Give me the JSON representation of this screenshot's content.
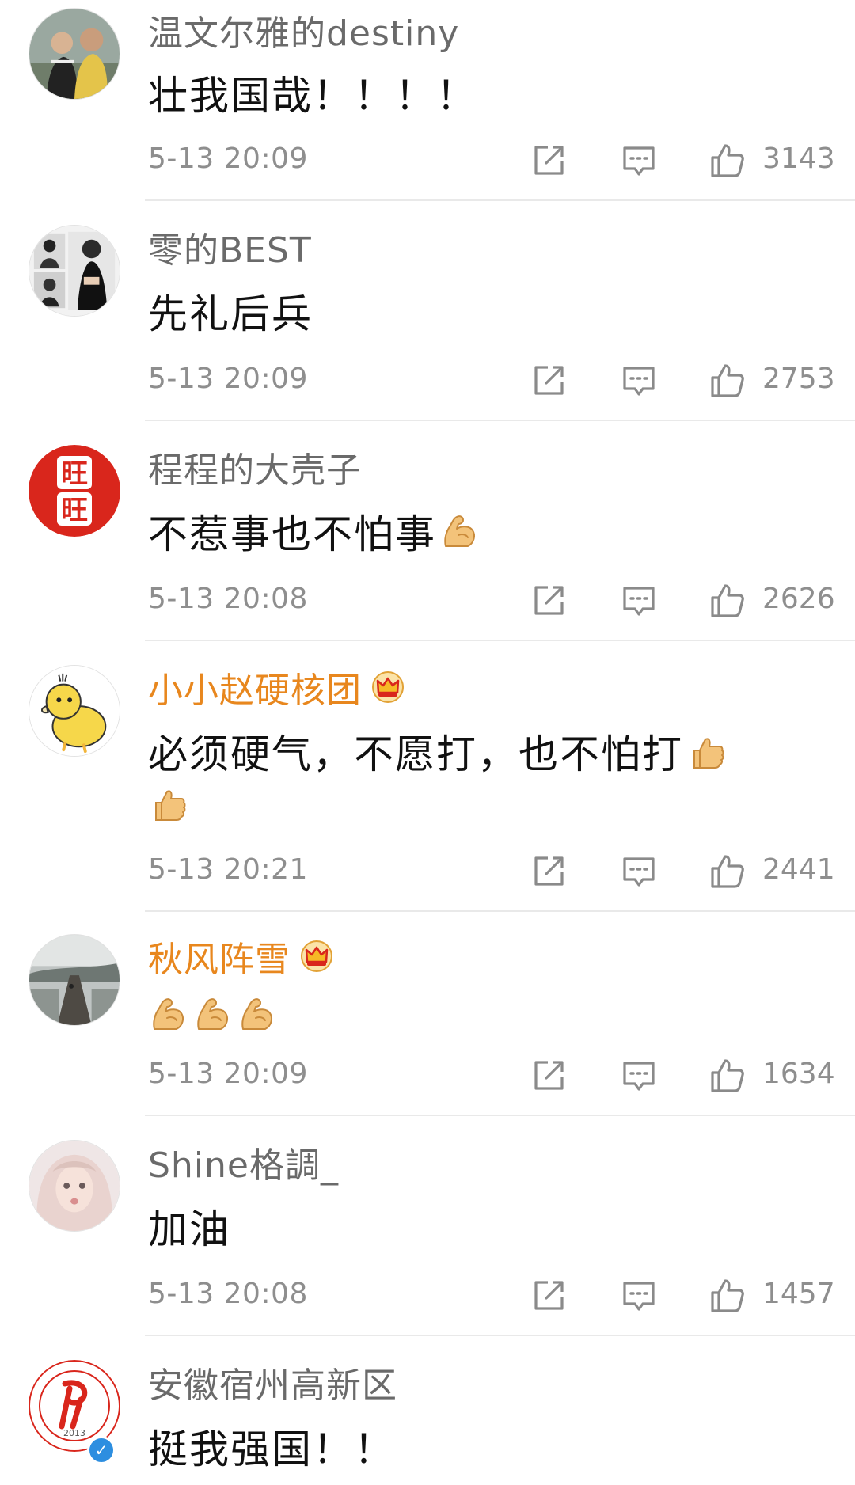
{
  "comments": [
    {
      "username": "温文尔雅的destiny",
      "vip": false,
      "text": "壮我国哉！！！！",
      "emojis": [],
      "timestamp": "5-13 20:09",
      "likes": "3143"
    },
    {
      "username": "零的BEST",
      "vip": false,
      "text": "先礼后兵",
      "emojis": [],
      "timestamp": "5-13 20:09",
      "likes": "2753"
    },
    {
      "username": "程程的大壳子",
      "vip": false,
      "text": "不惹事也不怕事",
      "emojis": [
        "flexed-biceps"
      ],
      "timestamp": "5-13 20:08",
      "likes": "2626"
    },
    {
      "username": "小小赵硬核团",
      "vip": true,
      "text": "必须硬气，不愿打，也不怕打",
      "emojis": [
        "thumbs-up",
        "thumbs-up"
      ],
      "timestamp": "5-13 20:21",
      "likes": "2441"
    },
    {
      "username": "秋风阵雪",
      "vip": true,
      "text": "",
      "emojis": [
        "flexed-biceps",
        "flexed-biceps",
        "flexed-biceps"
      ],
      "timestamp": "5-13 20:09",
      "likes": "1634"
    },
    {
      "username": "Shine格調_",
      "vip": false,
      "text": "加油",
      "emojis": [],
      "timestamp": "5-13 20:08",
      "likes": "1457"
    },
    {
      "username": "安徽宿州高新区",
      "vip": false,
      "verified": true,
      "text": "挺我强国！！",
      "emojis": []
    }
  ],
  "badge_seal_text": "2013",
  "avatar_text_wang": "旺",
  "colors": {
    "vip_name": "#e8871e",
    "name": "#6a6a6a",
    "meta": "#8e8e8e",
    "text": "#111111",
    "verified": "#2d8ee0",
    "avatar_red": "#d9261c"
  },
  "icons": [
    "share-icon",
    "reply-icon",
    "like-icon",
    "crown-icon",
    "flexed-biceps-emoji",
    "thumbs-up-emoji",
    "verified-icon"
  ]
}
